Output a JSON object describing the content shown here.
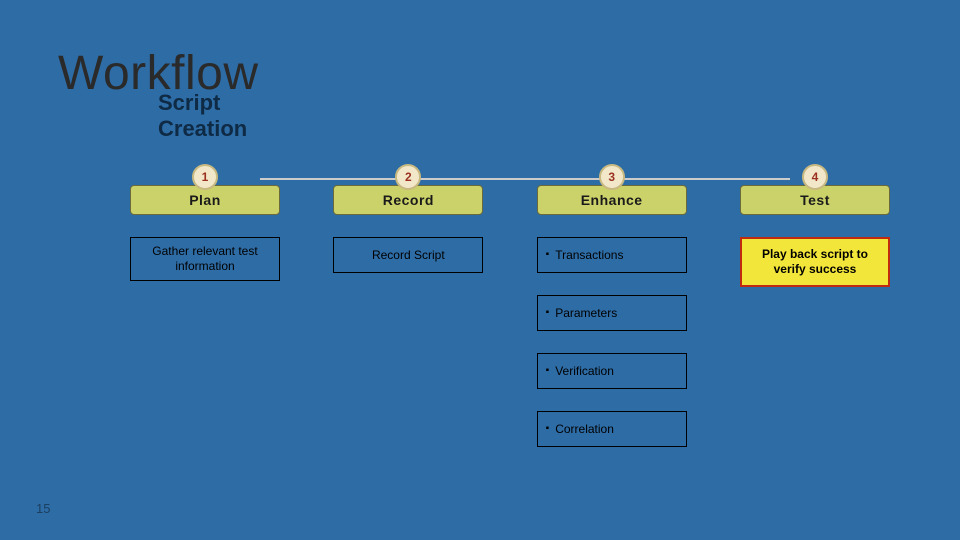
{
  "title": "Workflow",
  "subtitle": "Script Creation",
  "page_number": "15",
  "columns": [
    {
      "num": "1",
      "stage": "Plan",
      "boxes": [
        {
          "type": "plain-center",
          "text": "Gather relevant test information"
        }
      ]
    },
    {
      "num": "2",
      "stage": "Record",
      "boxes": [
        {
          "type": "plain-center",
          "text": "Record Script"
        }
      ]
    },
    {
      "num": "3",
      "stage": "Enhance",
      "boxes": [
        {
          "type": "bullet",
          "text": "Transactions"
        },
        {
          "type": "bullet",
          "text": "Parameters"
        },
        {
          "type": "bullet",
          "text": "Verification"
        },
        {
          "type": "bullet",
          "text": "Correlation"
        }
      ]
    },
    {
      "num": "4",
      "stage": "Test",
      "boxes": [
        {
          "type": "yellow",
          "text": "Play back script to verify success"
        }
      ]
    }
  ]
}
